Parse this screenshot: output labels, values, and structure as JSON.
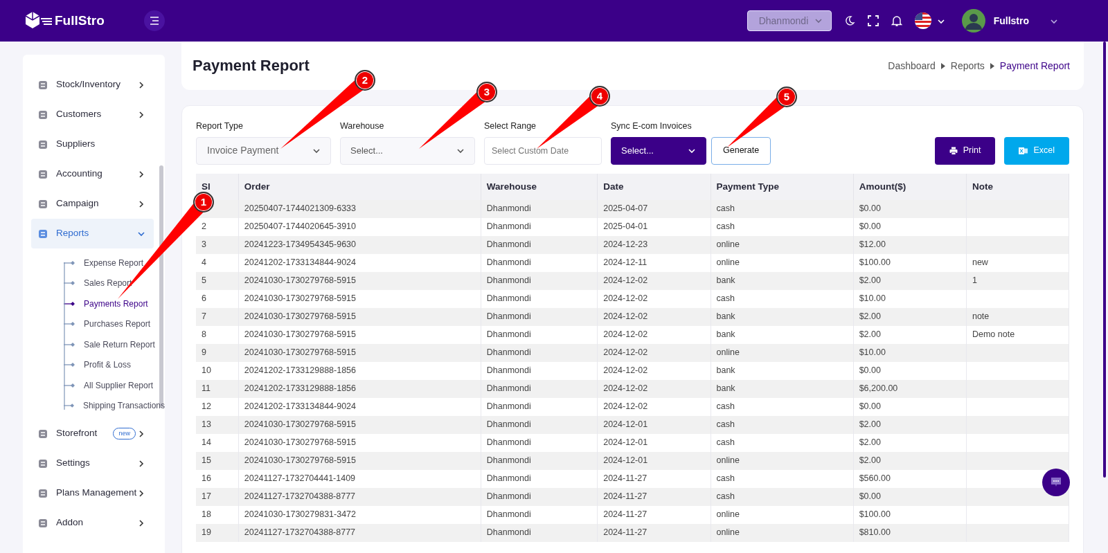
{
  "topbar": {
    "logo": "FullStro",
    "branch": "Dhanmondi",
    "user": "Fullstro"
  },
  "sidebar": {
    "items": [
      {
        "label": "Stock/Inventory",
        "expanded": false,
        "selected": false
      },
      {
        "label": "Customers",
        "expanded": false,
        "selected": false
      },
      {
        "label": "Suppliers",
        "selected": false
      },
      {
        "label": "Accounting",
        "expanded": false,
        "selected": false
      },
      {
        "label": "Campaign",
        "expanded": false,
        "selected": false
      },
      {
        "label": "Reports",
        "expanded": true,
        "selected": true,
        "children": [
          {
            "label": "Expense Report",
            "selected": false
          },
          {
            "label": "Sales Report",
            "selected": false
          },
          {
            "label": "Payments Report",
            "selected": true
          },
          {
            "label": "Purchases Report",
            "selected": false
          },
          {
            "label": "Sale Return Report",
            "selected": false
          },
          {
            "label": "Profit & Loss",
            "selected": false
          },
          {
            "label": "All Supplier Report",
            "selected": false
          },
          {
            "label": "Shipping Transactions",
            "selected": false
          }
        ]
      },
      {
        "label": "Storefront",
        "badge": "new",
        "expanded": false,
        "selected": false
      },
      {
        "label": "Settings",
        "expanded": false,
        "selected": false
      },
      {
        "label": "Plans Management",
        "expanded": false,
        "selected": false
      },
      {
        "label": "Addon",
        "expanded": false,
        "selected": false
      }
    ]
  },
  "header": {
    "title": "Payment Report",
    "breadcrumbs": [
      "Dashboard",
      "Reports",
      "Payment Report"
    ]
  },
  "filters": [
    {
      "kind": "select",
      "label": "Report Type",
      "value": "Invoice Payment"
    },
    {
      "kind": "select",
      "label": "Warehouse",
      "value": "Select..."
    },
    {
      "kind": "input",
      "label": "Select Range",
      "placeholder": "Select Custom Date"
    },
    {
      "kind": "dark-select",
      "label": "Sync E-com Invoices",
      "value": "Select..."
    }
  ],
  "buttons": [
    {
      "kind": "outline",
      "label": "Generate"
    },
    {
      "kind": "print",
      "label": "Print"
    },
    {
      "kind": "excel",
      "label": "Excel"
    }
  ],
  "table": {
    "columns": [
      "Sl",
      "Order",
      "Warehouse",
      "Date",
      "Payment Type",
      "Amount($)",
      "Note"
    ],
    "rows": [
      {
        "order": "20250407-1744021309-6333",
        "warehouse": "Dhanmondi",
        "date": "2025-04-07",
        "payment_type": "cash",
        "amount": "$0.00"
      },
      {
        "sl": "2",
        "order": "20250407-1744020645-3910",
        "warehouse": "Dhanmondi",
        "date": "2025-04-01",
        "payment_type": "cash",
        "amount": "$0.00"
      },
      {
        "sl": "3",
        "order": "20241223-1734954345-9630",
        "warehouse": "Dhanmondi",
        "date": "2024-12-23",
        "payment_type": "online",
        "amount": "$12.00"
      },
      {
        "sl": "4",
        "order": "20241202-1733134844-9024",
        "warehouse": "Dhanmondi",
        "date": "2024-12-11",
        "payment_type": "online",
        "amount": "$100.00",
        "note": "new"
      },
      {
        "sl": "5",
        "order": "20241030-1730279768-5915",
        "warehouse": "Dhanmondi",
        "date": "2024-12-02",
        "payment_type": "bank",
        "amount": "$2.00",
        "note": "1"
      },
      {
        "sl": "6",
        "order": "20241030-1730279768-5915",
        "warehouse": "Dhanmondi",
        "date": "2024-12-02",
        "payment_type": "cash",
        "amount": "$10.00"
      },
      {
        "sl": "7",
        "order": "20241030-1730279768-5915",
        "warehouse": "Dhanmondi",
        "date": "2024-12-02",
        "payment_type": "bank",
        "amount": "$2.00",
        "note": "note"
      },
      {
        "sl": "8",
        "order": "20241030-1730279768-5915",
        "warehouse": "Dhanmondi",
        "date": "2024-12-02",
        "payment_type": "bank",
        "amount": "$2.00",
        "note": "Demo note"
      },
      {
        "sl": "9",
        "order": "20241030-1730279768-5915",
        "warehouse": "Dhanmondi",
        "date": "2024-12-02",
        "payment_type": "online",
        "amount": "$10.00"
      },
      {
        "sl": "10",
        "order": "20241202-1733129888-1856",
        "warehouse": "Dhanmondi",
        "date": "2024-12-02",
        "payment_type": "bank",
        "amount": "$0.00"
      },
      {
        "sl": "11",
        "order": "20241202-1733129888-1856",
        "warehouse": "Dhanmondi",
        "date": "2024-12-02",
        "payment_type": "bank",
        "amount": "$6,200.00"
      },
      {
        "sl": "12",
        "order": "20241202-1733134844-9024",
        "warehouse": "Dhanmondi",
        "date": "2024-12-02",
        "payment_type": "cash",
        "amount": "$0.00"
      },
      {
        "sl": "13",
        "order": "20241030-1730279768-5915",
        "warehouse": "Dhanmondi",
        "date": "2024-12-01",
        "payment_type": "cash",
        "amount": "$2.00"
      },
      {
        "sl": "14",
        "order": "20241030-1730279768-5915",
        "warehouse": "Dhanmondi",
        "date": "2024-12-01",
        "payment_type": "cash",
        "amount": "$2.00"
      },
      {
        "sl": "15",
        "order": "20241030-1730279768-5915",
        "warehouse": "Dhanmondi",
        "date": "2024-12-01",
        "payment_type": "online",
        "amount": "$2.00"
      },
      {
        "sl": "16",
        "order": "20241127-1732704441-1409",
        "warehouse": "Dhanmondi",
        "date": "2024-11-27",
        "payment_type": "cash",
        "amount": "$560.00"
      },
      {
        "sl": "17",
        "order": "20241127-1732704388-8777",
        "warehouse": "Dhanmondi",
        "date": "2024-11-27",
        "payment_type": "cash",
        "amount": "$0.00"
      },
      {
        "sl": "18",
        "order": "20241030-1730279831-3472",
        "warehouse": "Dhanmondi",
        "date": "2024-11-27",
        "payment_type": "online",
        "amount": "$100.00"
      },
      {
        "sl": "19",
        "order": "20241127-1732704388-8777",
        "warehouse": "Dhanmondi",
        "date": "2024-11-27",
        "payment_type": "online",
        "amount": "$810.00"
      }
    ]
  },
  "callouts": [
    "1",
    "2",
    "3",
    "4",
    "5"
  ]
}
